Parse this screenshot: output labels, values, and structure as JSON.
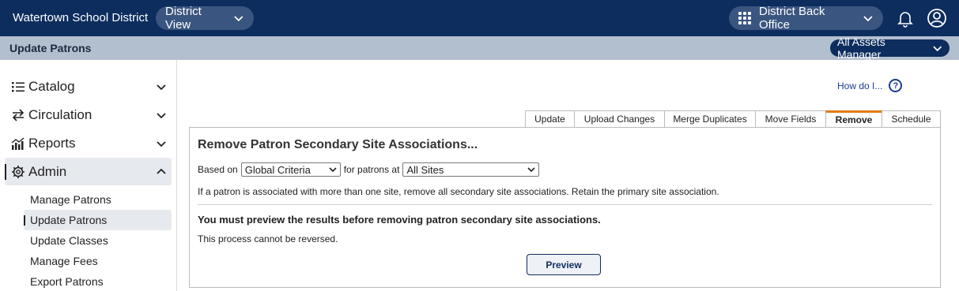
{
  "header": {
    "district_name": "Watertown School District",
    "view_label": "District View",
    "office_label": "District Back Office"
  },
  "subheader": {
    "title": "Update Patrons",
    "role_label": "All Assets Manager"
  },
  "sidebar": {
    "items": [
      {
        "label": "Catalog",
        "icon": "list-icon"
      },
      {
        "label": "Circulation",
        "icon": "arrows-swap-icon"
      },
      {
        "label": "Reports",
        "icon": "chart-icon"
      },
      {
        "label": "Admin",
        "icon": "gear-icon"
      }
    ],
    "admin_subitems": [
      {
        "label": "Manage Patrons"
      },
      {
        "label": "Update Patrons"
      },
      {
        "label": "Update Classes"
      },
      {
        "label": "Manage Fees"
      },
      {
        "label": "Export Patrons"
      }
    ]
  },
  "help": {
    "label": "How do I...",
    "icon_glyph": "?"
  },
  "tabs": [
    {
      "label": "Update"
    },
    {
      "label": "Upload Changes"
    },
    {
      "label": "Merge Duplicates"
    },
    {
      "label": "Move Fields"
    },
    {
      "label": "Remove"
    },
    {
      "label": "Schedule"
    }
  ],
  "panel": {
    "title": "Remove Patron Secondary Site Associations...",
    "based_on_label": "Based on",
    "criteria_value": "Global Criteria",
    "for_patrons_label": "for patrons at",
    "sites_value": "All Sites",
    "info_text": "If a patron is associated with more than one site, remove all secondary site associations. Retain the primary site association.",
    "warning_text": "You must preview the results before removing patron secondary site associations.",
    "note_text": "This process cannot be reversed.",
    "preview_label": "Preview"
  },
  "colors": {
    "header_bg": "#0d2d5e",
    "subheader_bg": "#b2bfcf",
    "active_tab_accent": "#e07a10",
    "link": "#1a3e8c"
  }
}
